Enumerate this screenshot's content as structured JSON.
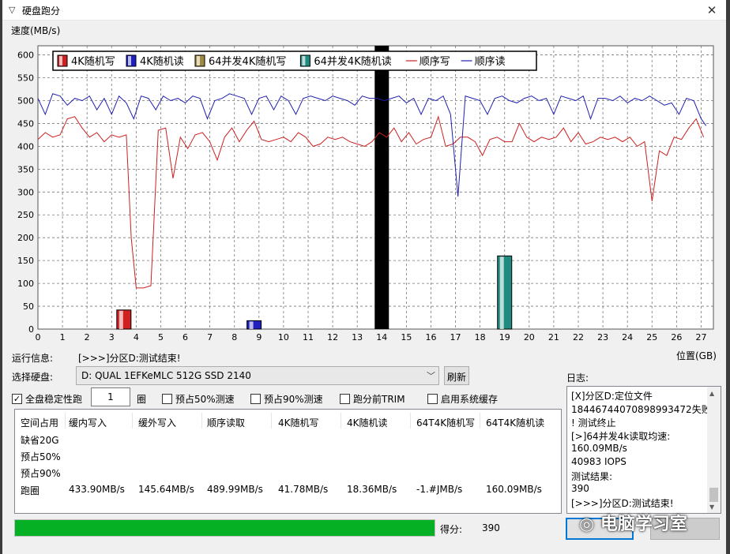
{
  "window": {
    "title": "硬盘跑分",
    "close_label": "✕"
  },
  "chart": {
    "y_label": "速度(MB/s)",
    "x_label": "位置(GB)",
    "legend": [
      "4K随机写",
      "4K随机读",
      "64并发4K随机写",
      "64并发4K随机读",
      "顺序写",
      "顺序读"
    ]
  },
  "chart_data": {
    "type": "line",
    "xlabel": "位置(GB)",
    "ylabel": "速度(MB/s)",
    "xlim": [
      0,
      27.5
    ],
    "ylim": [
      0,
      620
    ],
    "x_ticks": [
      0,
      1,
      2,
      3,
      4,
      5,
      6,
      7,
      8,
      9,
      10,
      11,
      12,
      13,
      14,
      15,
      16,
      17,
      18,
      19,
      20,
      21,
      22,
      23,
      24,
      25,
      26,
      27
    ],
    "y_ticks": [
      0,
      50,
      100,
      150,
      200,
      250,
      300,
      350,
      400,
      450,
      500,
      550,
      600
    ],
    "grid": true,
    "legend_position": "top",
    "current_position_marker": 14,
    "series": [
      {
        "name": "顺序写",
        "color": "#cc2020",
        "x": [
          0,
          0.3,
          0.6,
          0.9,
          1.2,
          1.5,
          1.8,
          2.1,
          2.4,
          2.7,
          3.0,
          3.3,
          3.6,
          3.8,
          4.0,
          4.3,
          4.6,
          4.9,
          5.2,
          5.5,
          5.8,
          6.1,
          6.4,
          6.7,
          7.0,
          7.3,
          7.6,
          7.9,
          8.2,
          8.5,
          8.8,
          9.1,
          9.4,
          9.7,
          10.0,
          10.3,
          10.6,
          10.9,
          11.2,
          11.5,
          11.8,
          12.1,
          12.4,
          12.7,
          13.0,
          13.3,
          13.6,
          13.9,
          14.2,
          14.5,
          14.8,
          15.1,
          15.4,
          15.7,
          16.0,
          16.3,
          16.6,
          16.9,
          17.2,
          17.5,
          17.8,
          18.1,
          18.4,
          18.7,
          19.0,
          19.3,
          19.6,
          19.9,
          20.2,
          20.5,
          20.8,
          21.1,
          21.4,
          21.7,
          22.0,
          22.3,
          22.6,
          22.9,
          23.2,
          23.5,
          23.8,
          24.1,
          24.4,
          24.7,
          25.0,
          25.3,
          25.6,
          25.9,
          26.2,
          26.5,
          26.8,
          27.1
        ],
        "values": [
          415,
          430,
          420,
          425,
          460,
          465,
          440,
          420,
          430,
          410,
          425,
          420,
          425,
          200,
          90,
          90,
          95,
          435,
          440,
          330,
          420,
          395,
          425,
          430,
          410,
          370,
          420,
          440,
          410,
          435,
          455,
          415,
          410,
          415,
          420,
          410,
          430,
          420,
          400,
          405,
          420,
          415,
          420,
          410,
          405,
          400,
          410,
          430,
          420,
          440,
          410,
          430,
          405,
          415,
          420,
          465,
          400,
          405,
          420,
          420,
          410,
          380,
          415,
          420,
          410,
          410,
          450,
          420,
          410,
          420,
          415,
          420,
          440,
          410,
          430,
          405,
          410,
          420,
          415,
          420,
          410,
          420,
          400,
          410,
          280,
          390,
          380,
          420,
          415,
          440,
          460,
          420
        ]
      },
      {
        "name": "顺序读",
        "color": "#2020b0",
        "x": [
          0,
          0.3,
          0.6,
          0.9,
          1.2,
          1.5,
          1.8,
          2.1,
          2.4,
          2.7,
          3.0,
          3.3,
          3.6,
          3.9,
          4.2,
          4.5,
          4.8,
          5.1,
          5.4,
          5.7,
          6.0,
          6.3,
          6.6,
          6.9,
          7.2,
          7.5,
          7.8,
          8.1,
          8.4,
          8.7,
          9.0,
          9.3,
          9.6,
          9.9,
          10.2,
          10.5,
          10.8,
          11.1,
          11.4,
          11.7,
          12.0,
          12.3,
          12.6,
          12.9,
          13.2,
          13.5,
          13.8,
          14.1,
          14.4,
          14.7,
          15.0,
          15.3,
          15.6,
          15.9,
          16.2,
          16.5,
          16.8,
          17.1,
          17.4,
          17.7,
          18.0,
          18.3,
          18.6,
          18.9,
          19.2,
          19.5,
          19.8,
          20.1,
          20.4,
          20.7,
          21.0,
          21.3,
          21.6,
          21.9,
          22.2,
          22.5,
          22.8,
          23.1,
          23.4,
          23.7,
          24.0,
          24.3,
          24.6,
          24.9,
          25.2,
          25.5,
          25.8,
          26.1,
          26.4,
          26.7,
          27.0,
          27.2
        ],
        "values": [
          505,
          470,
          515,
          510,
          490,
          505,
          500,
          510,
          480,
          505,
          470,
          510,
          495,
          460,
          510,
          505,
          480,
          510,
          500,
          505,
          495,
          510,
          505,
          460,
          500,
          505,
          515,
          510,
          505,
          470,
          505,
          510,
          480,
          510,
          500,
          470,
          505,
          510,
          505,
          500,
          510,
          505,
          500,
          490,
          510,
          505,
          505,
          500,
          505,
          510,
          495,
          505,
          470,
          505,
          500,
          510,
          470,
          290,
          510,
          505,
          500,
          470,
          505,
          510,
          500,
          495,
          505,
          510,
          500,
          505,
          470,
          510,
          505,
          500,
          510,
          460,
          505,
          505,
          500,
          510,
          495,
          505,
          500,
          510,
          500,
          490,
          495,
          470,
          505,
          500,
          460,
          445
        ]
      },
      {
        "name": "4K随机写",
        "type": "bar",
        "color": "#d02020",
        "x": [
          3.5
        ],
        "values": [
          41.78
        ]
      },
      {
        "name": "4K随机读",
        "type": "bar",
        "color": "#2020c0",
        "x": [
          8.8
        ],
        "values": [
          18.36
        ]
      },
      {
        "name": "64并发4K随机读",
        "type": "bar",
        "color": "#208a80",
        "x": [
          19.0
        ],
        "values": [
          160.09
        ]
      }
    ]
  },
  "controls": {
    "run_info_label": "运行信息:",
    "run_info_value": "[>>>]分区D:测试结束!",
    "select_disk_label": "选择硬盘:",
    "disk_value": "D: QUAL 1EFKeMLC 512G SSD 2140",
    "refresh_label": "刷新",
    "full_disk_label": "全盘稳定性跑",
    "loops_value": "1",
    "loops_unit": "圈",
    "pre50_label": "预占50%测速",
    "pre90_label": "预占90%测速",
    "trim_label": "跑分前TRIM",
    "cache_label": "启用系统缓存"
  },
  "results": {
    "headers": [
      "空间占用",
      "缓内写入",
      "缓外写入",
      "顺序读取",
      "4K随机写",
      "4K随机读",
      "64T4K随机写",
      "64T4K随机读"
    ],
    "rows": [
      "缺省20G",
      "预占50%",
      "预占90%"
    ],
    "run_label": "跑圈",
    "run_values": [
      "433.90MB/s",
      "145.64MB/s",
      "489.99MB/s",
      "41.78MB/s",
      "18.36MB/s",
      "-1.#JMB/s",
      "160.09MB/s"
    ]
  },
  "log": {
    "label": "日志:",
    "lines": [
      "[X]分区D:定位文件",
      "18446744070898993472失败",
      "! 测试终止",
      "[>]64并发4k读取均速:",
      "160.09MB/s",
      "40983 IOPS",
      "测试结果:",
      "390",
      "[>>>]分区D:测试结束!"
    ]
  },
  "score": {
    "label": "得分:",
    "value": "390"
  },
  "progress": {
    "fraction": 1.0,
    "color": "#06b025"
  },
  "watermark": "电脑学习室"
}
